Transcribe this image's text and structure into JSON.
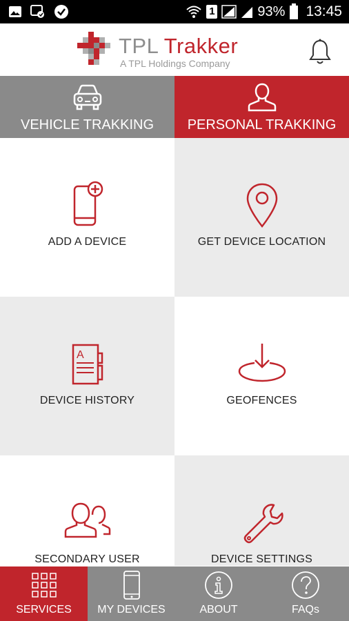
{
  "status_bar": {
    "battery_percent": "93%",
    "time": "13:45",
    "sim_number": "1"
  },
  "header": {
    "logo_title_part1": "TPL ",
    "logo_title_part2": "Trakker",
    "logo_subtitle": "A TPL Holdings Company"
  },
  "tabs": [
    {
      "label": "VEHICLE TRAKKING",
      "icon": "car-icon"
    },
    {
      "label": "PERSONAL TRAKKING",
      "icon": "person-icon"
    }
  ],
  "tiles": [
    {
      "label": "ADD A DEVICE",
      "icon": "add-device-icon"
    },
    {
      "label": "GET DEVICE LOCATION",
      "icon": "location-pin-icon"
    },
    {
      "label": "DEVICE HISTORY",
      "icon": "history-document-icon"
    },
    {
      "label": "GEOFENCES",
      "icon": "geofence-icon"
    },
    {
      "label": "SECONDARY USER",
      "icon": "users-icon"
    },
    {
      "label": "DEVICE SETTINGS",
      "icon": "wrench-icon"
    }
  ],
  "bottom_nav": [
    {
      "label": "SERVICES",
      "icon": "grid-icon"
    },
    {
      "label": "MY DEVICES",
      "icon": "phone-icon"
    },
    {
      "label": "ABOUT",
      "icon": "info-icon"
    },
    {
      "label": "FAQs",
      "icon": "question-icon"
    }
  ],
  "colors": {
    "brand_red": "#c0252c",
    "tab_grey": "#8a8a8a",
    "tile_grey": "#ebebeb"
  }
}
